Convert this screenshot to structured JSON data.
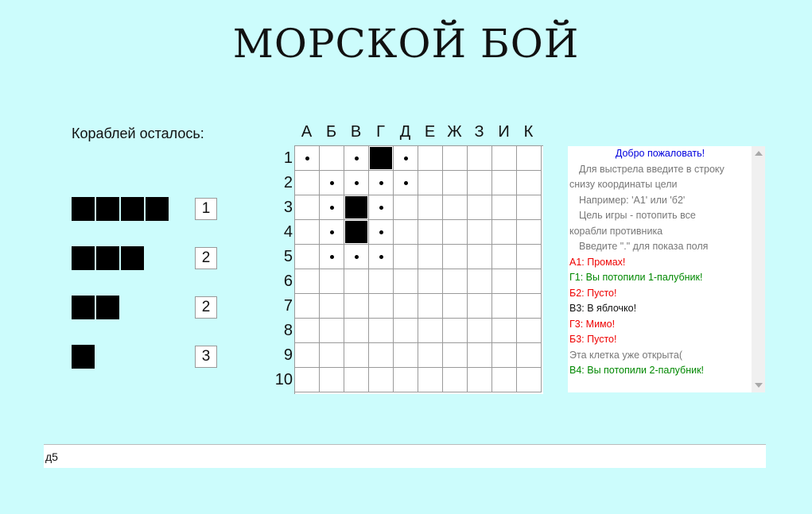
{
  "title": "МОРСКОЙ БОЙ",
  "ships_left_label": "Кораблей осталось:",
  "fleet": [
    {
      "decks": 4,
      "count": "1"
    },
    {
      "decks": 3,
      "count": "2"
    },
    {
      "decks": 2,
      "count": "2"
    },
    {
      "decks": 1,
      "count": "3"
    }
  ],
  "board": {
    "columns": [
      "А",
      "Б",
      "В",
      "Г",
      "Д",
      "Е",
      "Ж",
      "З",
      "И",
      "К"
    ],
    "rows": [
      "1",
      "2",
      "3",
      "4",
      "5",
      "6",
      "7",
      "8",
      "9",
      "10"
    ],
    "hits": [
      [
        0,
        3
      ],
      [
        2,
        2
      ],
      [
        3,
        2
      ]
    ],
    "misses": [
      [
        0,
        0
      ],
      [
        0,
        2
      ],
      [
        0,
        4
      ],
      [
        1,
        1
      ],
      [
        1,
        2
      ],
      [
        1,
        3
      ],
      [
        1,
        4
      ],
      [
        2,
        1
      ],
      [
        2,
        3
      ],
      [
        3,
        1
      ],
      [
        3,
        3
      ],
      [
        4,
        1
      ],
      [
        4,
        2
      ],
      [
        4,
        3
      ]
    ]
  },
  "log": [
    {
      "text": "Добро пожаловать!",
      "color": "#0000dd",
      "style": "center"
    },
    {
      "text": "Для выстрела введите в строку",
      "color": "#777777",
      "style": "indent"
    },
    {
      "text": "снизу координаты цели",
      "color": "#777777",
      "style": ""
    },
    {
      "text": "Например: 'А1' или 'б2'",
      "color": "#777777",
      "style": "indent"
    },
    {
      "text": "Цель игры - потопить все",
      "color": "#777777",
      "style": "indent"
    },
    {
      "text": "корабли противника",
      "color": "#777777",
      "style": ""
    },
    {
      "text": "Введите \".\" для показа поля",
      "color": "#777777",
      "style": "indent"
    },
    {
      "text": "А1: Промах!",
      "color": "#ee0000",
      "style": ""
    },
    {
      "text": "Г1: Вы потопили 1-палубник!",
      "color": "#008800",
      "style": ""
    },
    {
      "text": "Б2: Пусто!",
      "color": "#ee0000",
      "style": ""
    },
    {
      "text": "В3: В яблочко!",
      "color": "#111111",
      "style": ""
    },
    {
      "text": "Г3: Мимо!",
      "color": "#ee0000",
      "style": ""
    },
    {
      "text": "Б3: Пусто!",
      "color": "#ee0000",
      "style": ""
    },
    {
      "text": "Эта клетка уже открыта(",
      "color": "#777777",
      "style": ""
    },
    {
      "text": "В4: Вы потопили 2-палубник!",
      "color": "#008800",
      "style": ""
    }
  ],
  "input": {
    "value": "д5"
  }
}
